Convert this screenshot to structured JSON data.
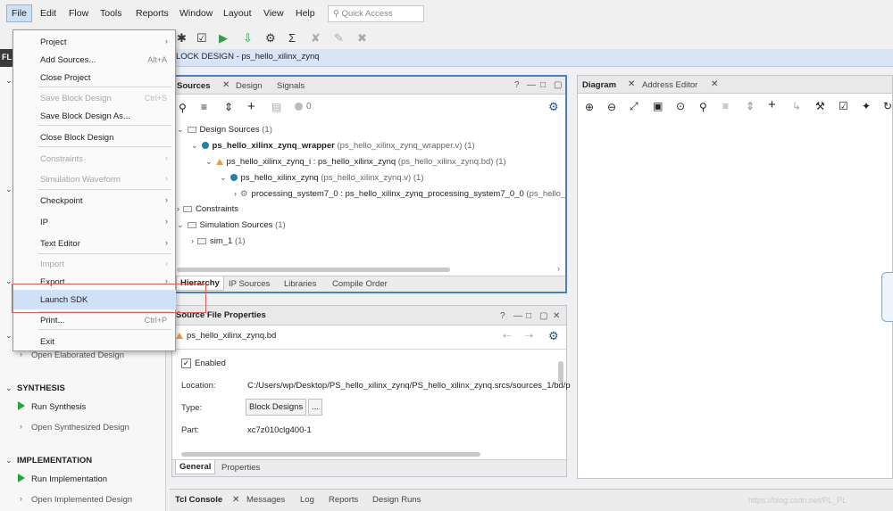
{
  "menubar": {
    "items": [
      "File",
      "Edit",
      "Flow",
      "Tools",
      "Reports",
      "Window",
      "Layout",
      "View",
      "Help"
    ],
    "quick_access_placeholder": "Quick Access"
  },
  "header": {
    "flow_strip_label": "FL",
    "block_design_title": "LOCK DESIGN - ps_hello_xilinx_zynq"
  },
  "file_menu": {
    "items": [
      {
        "label": "Project",
        "submenu": true
      },
      {
        "label": "Add Sources...",
        "shortcut": "Alt+A"
      },
      {
        "label": "Close Project"
      },
      {
        "label": "Save Block Design",
        "shortcut": "Ctrl+S",
        "disabled": true
      },
      {
        "label": "Save Block Design As..."
      },
      {
        "label": "Close Block Design"
      },
      {
        "label": "Constraints",
        "submenu": true,
        "disabled": true
      },
      {
        "label": "Simulation Waveform",
        "submenu": true,
        "disabled": true
      },
      {
        "label": "Checkpoint",
        "submenu": true
      },
      {
        "label": "IP",
        "submenu": true
      },
      {
        "label": "Text Editor",
        "submenu": true
      },
      {
        "label": "Import",
        "submenu": true,
        "disabled": true
      },
      {
        "label": "Export",
        "submenu": true
      },
      {
        "label": "Launch SDK",
        "highlighted": true
      },
      {
        "label": "Print...",
        "shortcut": "Ctrl+P"
      },
      {
        "label": "Exit"
      }
    ]
  },
  "flow_navigator": {
    "open_elaborated": "Open Elaborated Design",
    "synthesis_heading": "SYNTHESIS",
    "run_synthesis": "Run Synthesis",
    "open_synthesized": "Open Synthesized Design",
    "implementation_heading": "IMPLEMENTATION",
    "run_implementation": "Run Implementation",
    "open_implemented": "Open Implemented Design"
  },
  "sources_panel": {
    "tabs": [
      "Sources",
      "Design",
      "Signals"
    ],
    "badge_count": "0",
    "tree": {
      "design_sources": "Design Sources",
      "design_sources_count": "(1)",
      "wrapper_name": "ps_hello_xilinx_zynq_wrapper",
      "wrapper_detail": "(ps_hello_xilinx_zynq_wrapper.v) (1)",
      "bd_instance": "ps_hello_xilinx_zynq_i : ps_hello_xilinx_zynq",
      "bd_instance_detail": "(ps_hello_xilinx_zynq.bd) (1)",
      "zynq_name": "ps_hello_xilinx_zynq",
      "zynq_detail": "(ps_hello_xilinx_zynq.v) (1)",
      "ps7_name": "processing_system7_0 : ps_hello_xilinx_zynq_processing_system7_0_0",
      "ps7_detail": "(ps_hello_",
      "constraints": "Constraints",
      "simulation_sources": "Simulation Sources",
      "simulation_sources_count": "(1)",
      "sim_1": "sim_1",
      "sim_1_count": "(1)"
    },
    "bottom_tabs": [
      "Hierarchy",
      "IP Sources",
      "Libraries",
      "Compile Order"
    ]
  },
  "properties_panel": {
    "title": "Source File Properties",
    "file_name": "ps_hello_xilinx_zynq.bd",
    "enabled_label": "Enabled",
    "location_label": "Location:",
    "location_value": "C:/Users/wp/Desktop/PS_hello_xilinx_zynq/PS_hello_xilinx_zynq.srcs/sources_1/bd/p",
    "type_label": "Type:",
    "type_value": "Block Designs",
    "type_more": "...",
    "part_label": "Part:",
    "part_value": "xc7z010clg400-1",
    "bottom_tabs": [
      "General",
      "Properties"
    ]
  },
  "diagram_panel": {
    "tabs": [
      "Diagram",
      "Address Editor"
    ]
  },
  "console_tabs": [
    "Tcl Console",
    "Messages",
    "Log",
    "Reports",
    "Design Runs"
  ],
  "watermark": "https://blog.csdn.net/PL_PL",
  "colors": {
    "accent_selection": "#cfe1f7",
    "run_green": "#27a344",
    "highlight_box": "#e05a5a"
  }
}
